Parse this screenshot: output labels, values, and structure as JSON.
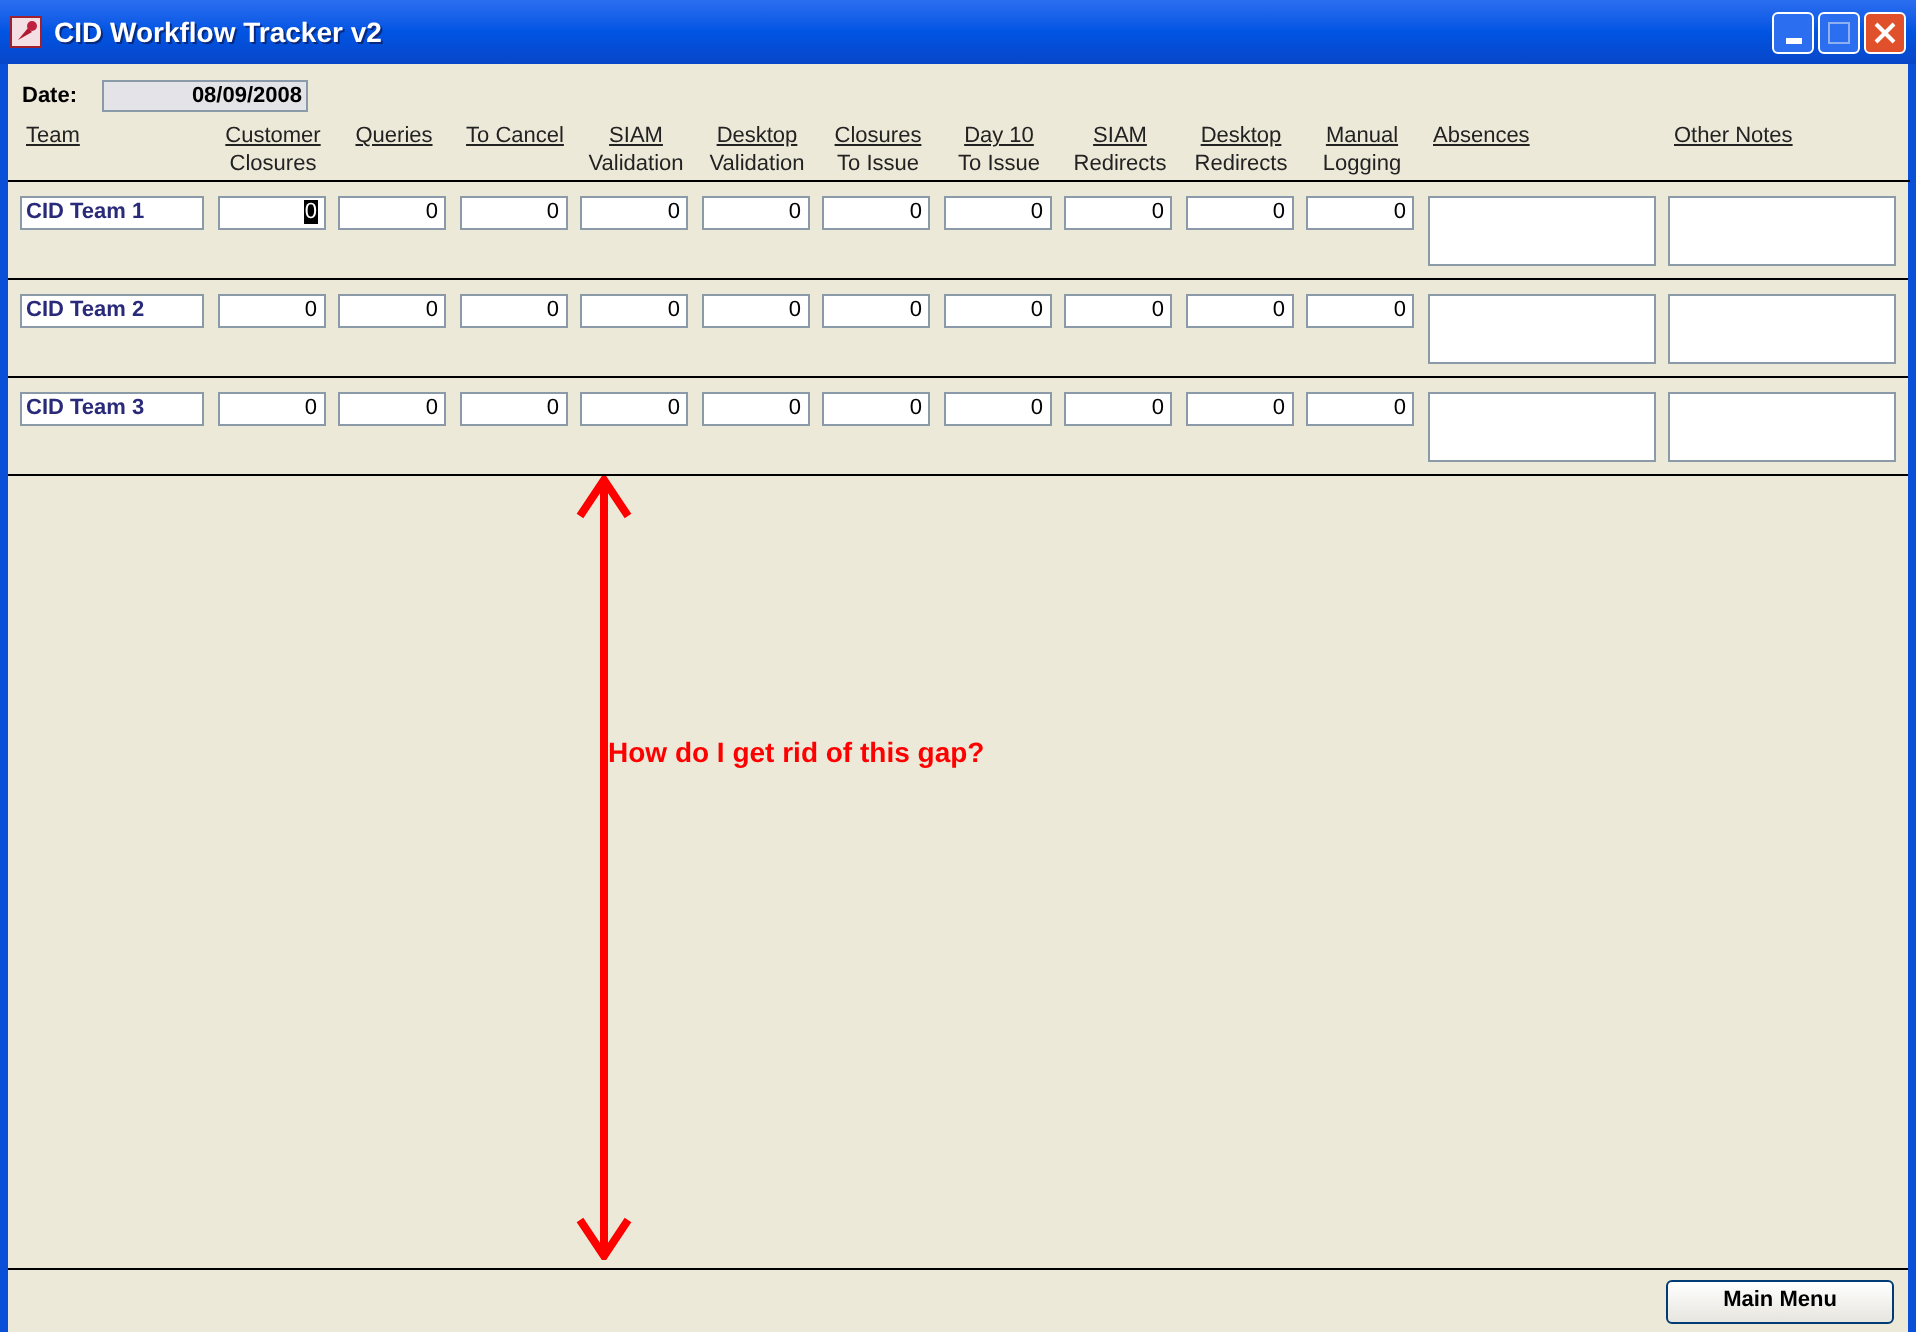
{
  "window": {
    "title": "CID Workflow Tracker v2"
  },
  "date": {
    "label": "Date:",
    "value": "08/09/2008"
  },
  "columns": [
    {
      "kind": "text",
      "lines": [
        "Team"
      ]
    },
    {
      "kind": "count",
      "lines": [
        "Customer",
        "Closures"
      ]
    },
    {
      "kind": "count",
      "lines": [
        "Queries"
      ]
    },
    {
      "kind": "count",
      "lines": [
        "To Cancel"
      ]
    },
    {
      "kind": "count",
      "lines": [
        "SIAM",
        "Validation"
      ]
    },
    {
      "kind": "count",
      "lines": [
        "Desktop",
        "Validation"
      ]
    },
    {
      "kind": "count",
      "lines": [
        "Closures",
        "To Issue"
      ]
    },
    {
      "kind": "count",
      "lines": [
        "Day 10",
        "To Issue"
      ]
    },
    {
      "kind": "count",
      "lines": [
        "SIAM",
        "Redirects"
      ]
    },
    {
      "kind": "count",
      "lines": [
        "Desktop",
        "Redirects"
      ]
    },
    {
      "kind": "count",
      "lines": [
        "Manual",
        "Logging"
      ]
    },
    {
      "kind": "text",
      "lines": [
        "Absences"
      ]
    },
    {
      "kind": "text",
      "lines": [
        "Other Notes"
      ]
    }
  ],
  "rows": [
    {
      "team": "CID Team 1",
      "counts": [
        {
          "value": "0",
          "focused": true
        },
        {
          "value": "0",
          "focused": false
        },
        {
          "value": "0",
          "focused": false
        },
        {
          "value": "0",
          "focused": false
        },
        {
          "value": "0",
          "focused": false
        },
        {
          "value": "0",
          "focused": false
        },
        {
          "value": "0",
          "focused": false
        },
        {
          "value": "0",
          "focused": false
        },
        {
          "value": "0",
          "focused": false
        },
        {
          "value": "0",
          "focused": false
        }
      ]
    },
    {
      "team": "CID Team 2",
      "counts": [
        {
          "value": "0",
          "focused": false
        },
        {
          "value": "0",
          "focused": false
        },
        {
          "value": "0",
          "focused": false
        },
        {
          "value": "0",
          "focused": false
        },
        {
          "value": "0",
          "focused": false
        },
        {
          "value": "0",
          "focused": false
        },
        {
          "value": "0",
          "focused": false
        },
        {
          "value": "0",
          "focused": false
        },
        {
          "value": "0",
          "focused": false
        },
        {
          "value": "0",
          "focused": false
        }
      ]
    },
    {
      "team": "CID Team 3",
      "counts": [
        {
          "value": "0",
          "focused": false
        },
        {
          "value": "0",
          "focused": false
        },
        {
          "value": "0",
          "focused": false
        },
        {
          "value": "0",
          "focused": false
        },
        {
          "value": "0",
          "focused": false
        },
        {
          "value": "0",
          "focused": false
        },
        {
          "value": "0",
          "focused": false
        },
        {
          "value": "0",
          "focused": false
        },
        {
          "value": "0",
          "focused": false
        },
        {
          "value": "0",
          "focused": false
        }
      ]
    }
  ],
  "annotation": {
    "text": "How do I get rid of this gap?"
  },
  "footer": {
    "button": "Main Menu"
  }
}
